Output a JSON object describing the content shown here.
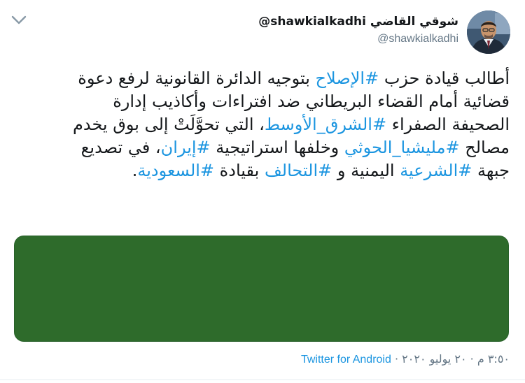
{
  "tweet": {
    "display_name": "شوقي القاضي",
    "display_handle": "@shawkialkadhi",
    "screen_name": "@shawkialkadhi",
    "body": [
      {
        "t": "text",
        "v": "أطالب قيادة حزب "
      },
      {
        "t": "tag",
        "v": "#الإصلاح"
      },
      {
        "t": "text",
        "v": " بتوجيه الدائرة القانونية لرفع دعوة قضائية أمام القضاء البريطاني ضد افتراءات وأكاذيب إدارة الصحيفة الصفراء "
      },
      {
        "t": "tag",
        "v": "#الشرق_الأوسط"
      },
      {
        "t": "text",
        "v": "، التي تحوَّلَتْ إلى بوق يخدم مصالح "
      },
      {
        "t": "tag",
        "v": "#مليشيا_الحوثي"
      },
      {
        "t": "text",
        "v": " وخلفها استراتيجية "
      },
      {
        "t": "tag",
        "v": "#إيران"
      },
      {
        "t": "text",
        "v": "، في تصديع جبهة "
      },
      {
        "t": "tag",
        "v": "#الشرعية"
      },
      {
        "t": "text",
        "v": " اليمنية و "
      },
      {
        "t": "tag",
        "v": "#التحالف"
      },
      {
        "t": "text",
        "v": " بقيادة "
      },
      {
        "t": "tag",
        "v": "#السعودية"
      },
      {
        "t": "text",
        "v": "."
      }
    ],
    "timestamp": "٣:٥٠ م · ٢٠ يوليو ٢٠٢٠ ·",
    "source": "Twitter for Android"
  },
  "colors": {
    "link": "#1b95e0",
    "secondary_text": "#657786",
    "media_fill": "#2e6b2b"
  },
  "icons": {
    "menu": "chevron-down-icon",
    "avatar": "avatar"
  }
}
